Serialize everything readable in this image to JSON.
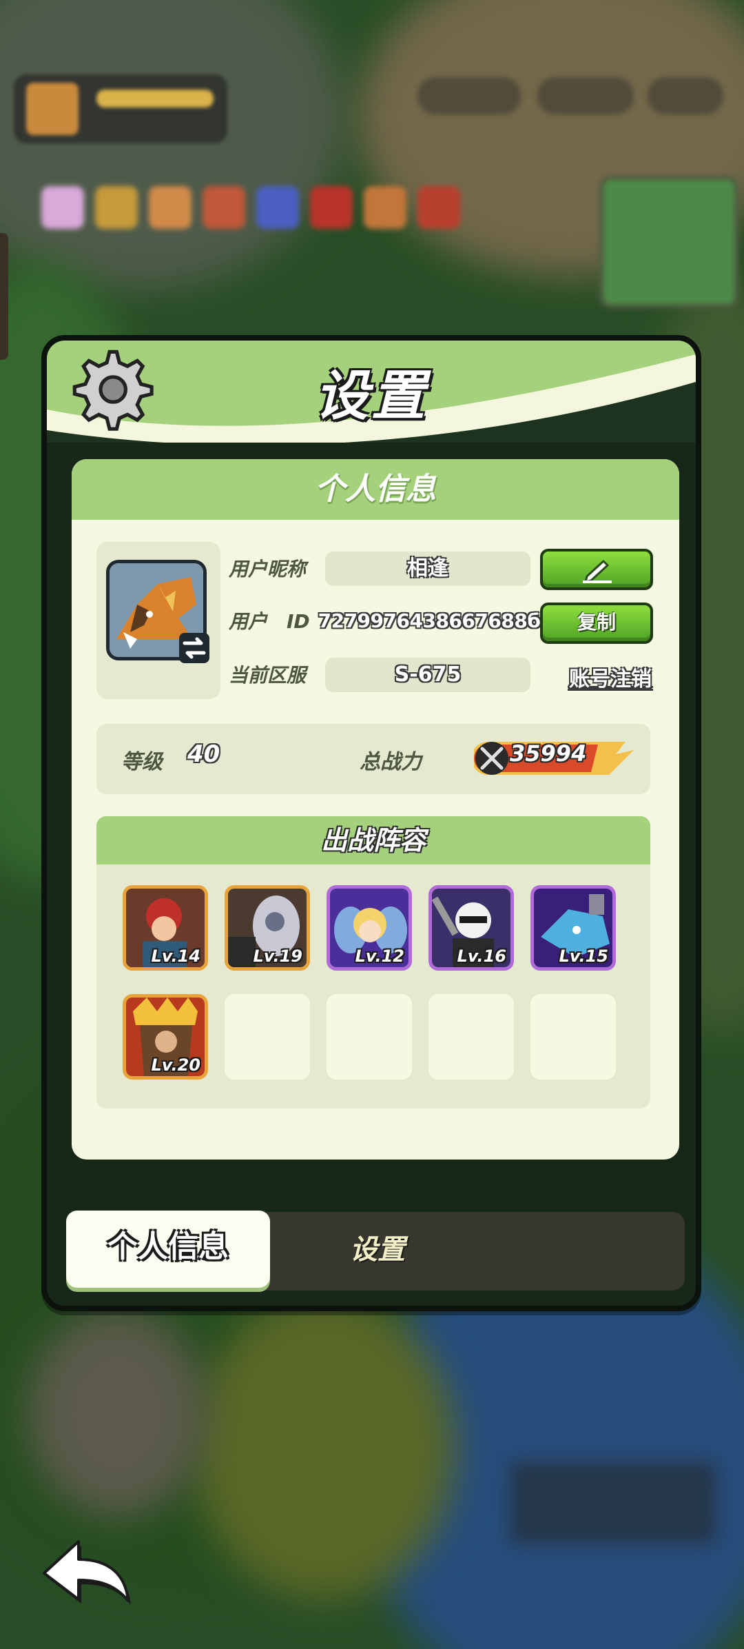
{
  "panel": {
    "title": "设置"
  },
  "profile": {
    "section_title": "个人信息",
    "nickname_label": "用户昵称",
    "nickname_value": "相逢",
    "id_label": "用户　ID",
    "id_value": "7279976438667688б",
    "server_label": "当前区服",
    "server_value": "S-675",
    "copy_button": "复制",
    "cancel_account_link": "账号注销"
  },
  "stats": {
    "level_label": "等级",
    "level_value": "40",
    "power_label": "总战力",
    "power_value": "35994"
  },
  "lineup": {
    "title": "出战阵容",
    "heroes": [
      {
        "level": "Lv.14",
        "rarity": "gold",
        "color": "#b3302a"
      },
      {
        "level": "Lv.19",
        "rarity": "gold",
        "color": "#6b6f88"
      },
      {
        "level": "Lv.12",
        "rarity": "purple",
        "color": "#8f74d9"
      },
      {
        "level": "Lv.16",
        "rarity": "purple",
        "color": "#5b5277"
      },
      {
        "level": "Lv.15",
        "rarity": "purple",
        "color": "#3b8fc4"
      },
      {
        "level": "Lv.20",
        "rarity": "gold",
        "color": "#8a4b22"
      }
    ],
    "empty_slots": 4
  },
  "tabs": {
    "active": "个人信息",
    "inactive": "设置"
  },
  "colors": {
    "accent_green": "#a5d17d",
    "button_green": "#4fa325",
    "panel_dark": "#172819",
    "card_bg": "#f6f9e2"
  },
  "icons": {
    "header": "gear-icon",
    "edit": "pencil-icon",
    "avatar_swap": "swap-icon",
    "power": "crossed-swords-icon",
    "back": "back-arrow-icon"
  }
}
